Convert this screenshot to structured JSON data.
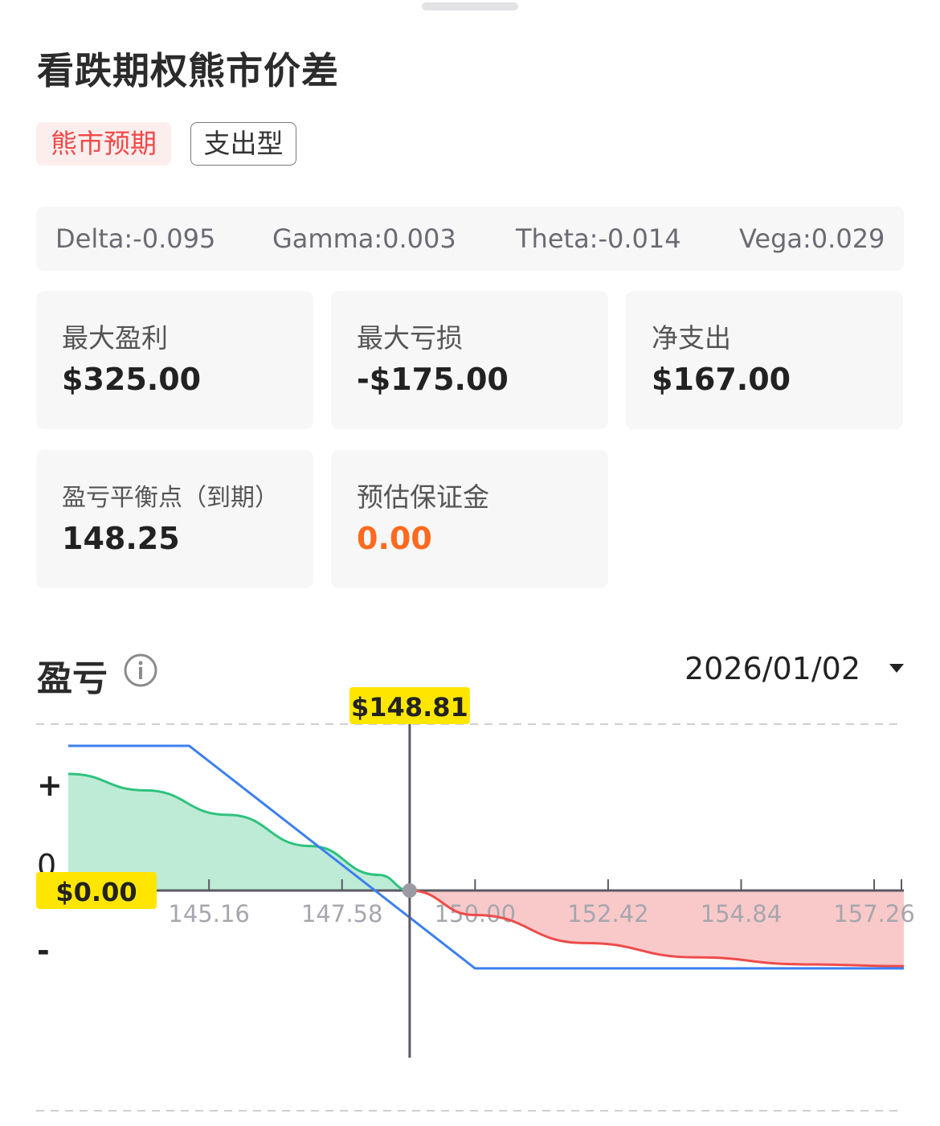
{
  "title": "看跌期权熊市价差",
  "tags": [
    "熊市预期",
    "支出型"
  ],
  "greeks": [
    {
      "text": "Delta:-0.095"
    },
    {
      "text": "Gamma:0.003"
    },
    {
      "text": "Theta:-0.014"
    },
    {
      "text": "Vega:0.029"
    }
  ],
  "metrics": [
    {
      "label": "最大盈利",
      "value": "$325.00"
    },
    {
      "label": "最大亏损",
      "value": "-$175.00"
    },
    {
      "label": "净支出",
      "value": "$167.00"
    },
    {
      "label": "盈亏平衡点（到期）",
      "value": "148.25"
    },
    {
      "label": "预估保证金",
      "value": "0.00"
    }
  ],
  "pnl": {
    "title": "盈亏",
    "date": "2026/01/02",
    "info_icon": "info-icon",
    "dropdown_icon": "caret-down-icon"
  },
  "chart_data": {
    "type": "line",
    "x_ticks": [
      "145.16",
      "147.58",
      "150.00",
      "152.42",
      "154.84",
      "157.26"
    ],
    "y_markers": {
      "plus": "+",
      "zero": "0",
      "minus": "-"
    },
    "current_price_label": "$148.81",
    "current_price": 148.81,
    "zero_label": "$0.00",
    "xlim": [
      142.6,
      157.8
    ],
    "colors": {
      "expiry_line": "#3b7ff0",
      "profit": "#2ec27e",
      "loss": "#ee4b4b",
      "profit_fill": "#bdebd5",
      "loss_fill": "#f9c9c9",
      "marker_bg": "#ffe600"
    },
    "series": [
      {
        "x": [
          142.6,
          144.8,
          150.0,
          157.8
        ],
        "y": [
          325,
          325,
          -175,
          -175
        ]
      },
      {
        "x": [
          142.6,
          144.0,
          145.5,
          147.0,
          148.25,
          148.81,
          150.0,
          152.0,
          154.0,
          156.0,
          157.8
        ],
        "y": [
          262,
          225,
          170,
          100,
          35,
          0,
          -55,
          -118,
          -150,
          -166,
          -170
        ]
      }
    ]
  }
}
